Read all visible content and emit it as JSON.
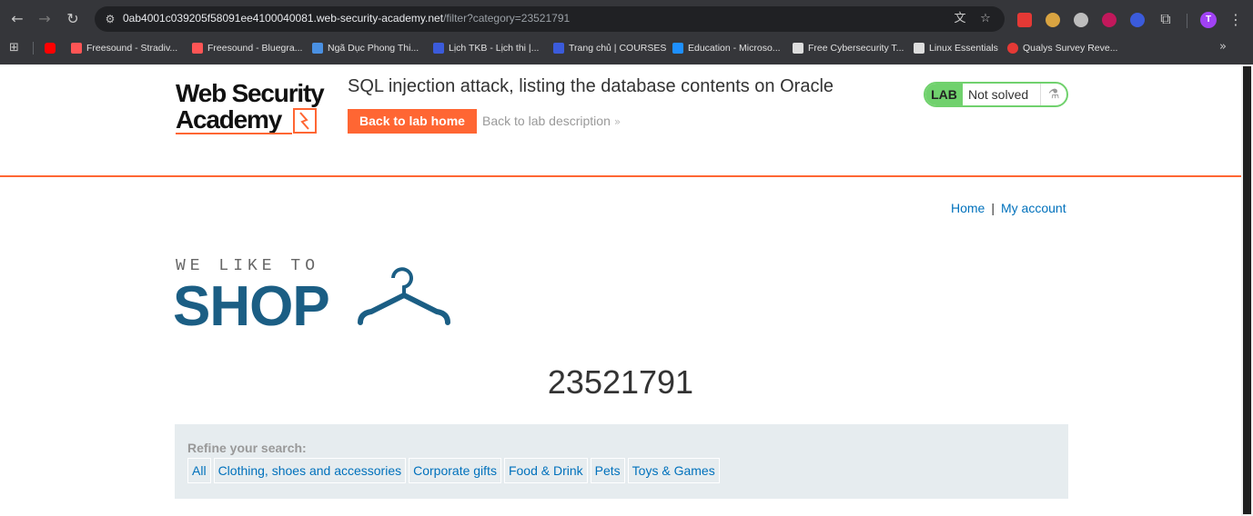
{
  "browser": {
    "url_host": "0ab4001c039205f58091ee4100040081.web-security-academy.net",
    "url_path": "/filter?category=23521791",
    "profile_initial": "T",
    "bookmarks": [
      {
        "label": "Freesound - Stradiv...",
        "color": "#ff5555"
      },
      {
        "label": "Freesound - Bluegra...",
        "color": "#ff5555"
      },
      {
        "label": "Ngã Dục Phong Thi...",
        "color": "#4a90e2"
      },
      {
        "label": "Lịch TKB - Lịch thi |...",
        "color": "#3b5bdb"
      },
      {
        "label": "Trang chủ | COURSES",
        "color": "#3b5bdb"
      },
      {
        "label": "Education - Microso...",
        "color": "#1e90ff"
      },
      {
        "label": "Free Cybersecurity T...",
        "color": "#dddddd"
      },
      {
        "label": "Linux Essentials",
        "color": "#dddddd"
      },
      {
        "label": "Qualys Survey Reve...",
        "color": "#e53935"
      }
    ]
  },
  "academy": {
    "logo_line1": "Web Security",
    "logo_line2": "Academy",
    "lab_title": "SQL injection attack, listing the database contents on Oracle",
    "back_home": "Back to lab home",
    "back_description": "Back to lab description",
    "lab_badge": "LAB",
    "lab_status": "Not solved",
    "accent_color": "#ff6633",
    "solved_color": "#70d16d"
  },
  "shop": {
    "nav_home": "Home",
    "nav_separator": "|",
    "nav_account": "My account",
    "tagline": "WE LIKE TO",
    "brand": "SHOP",
    "category_title": "23521791",
    "refine_label": "Refine your search:",
    "filters": [
      "All",
      "Clothing, shoes and accessories",
      "Corporate gifts",
      "Food & Drink",
      "Pets",
      "Toys & Games"
    ],
    "brand_color": "#1b5e84",
    "link_color": "#0071bc"
  }
}
